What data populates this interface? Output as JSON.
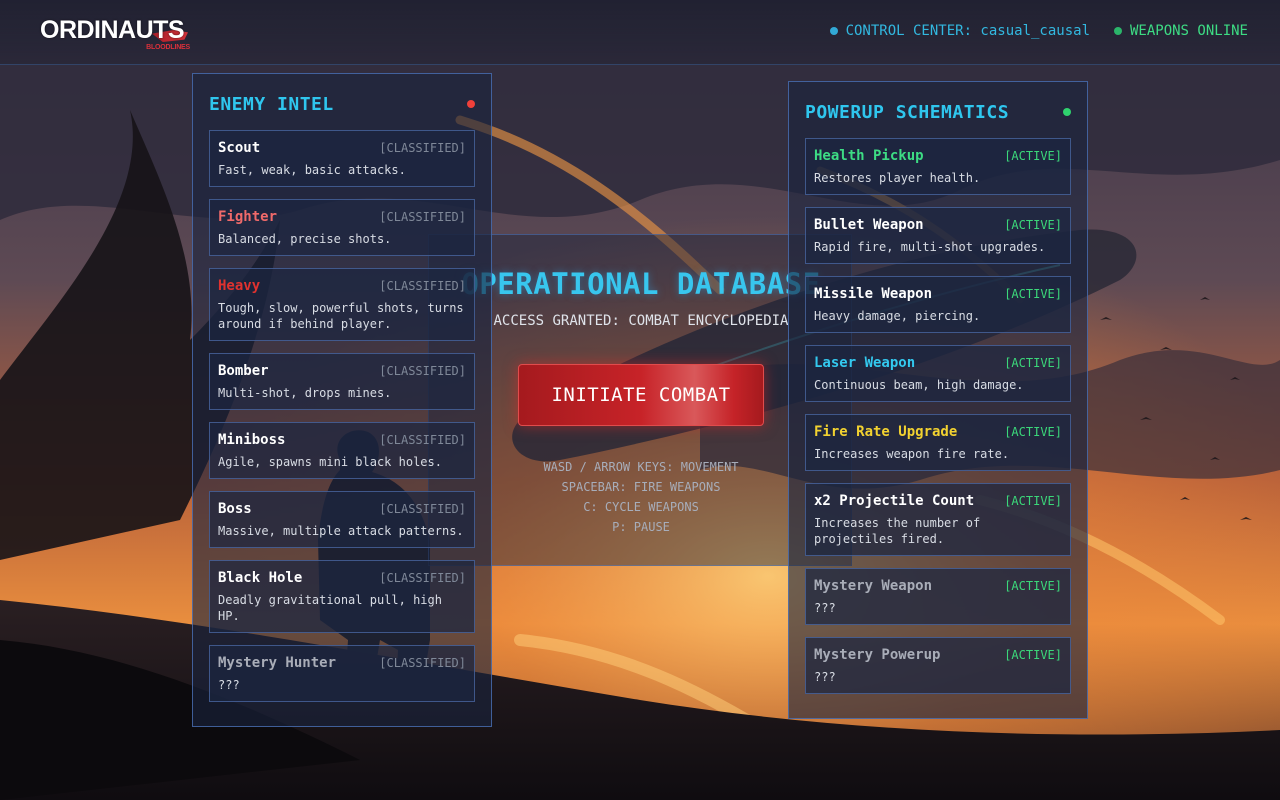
{
  "header": {
    "logo_main": "ORDINAUTS",
    "logo_sub": "BLOODLINES",
    "control_center": "CONTROL CENTER: casual_causal",
    "weapons_status": "WEAPONS ONLINE"
  },
  "colors": {
    "accent_cyan": "#2fc6ee",
    "status_green": "#3ddc84",
    "danger_red": "#c72328",
    "fighter": "#f06a6a",
    "heavy": "#e0322f",
    "laser": "#33c9ef",
    "fire_rate": "#f2d230",
    "health": "#3ddc84",
    "mystery": "#a9adb8"
  },
  "enemy_panel": {
    "title": "ENEMY INTEL",
    "indicator_icon": "status-dot-red",
    "items": [
      {
        "name": "Scout",
        "tag": "[CLASSIFIED]",
        "desc": "Fast, weak, basic attacks.",
        "color": "#ffffff"
      },
      {
        "name": "Fighter",
        "tag": "[CLASSIFIED]",
        "desc": "Balanced, precise shots.",
        "color": "#f06a6a"
      },
      {
        "name": "Heavy",
        "tag": "[CLASSIFIED]",
        "desc": "Tough, slow, powerful shots, turns around if behind player.",
        "color": "#e0322f"
      },
      {
        "name": "Bomber",
        "tag": "[CLASSIFIED]",
        "desc": "Multi-shot, drops mines.",
        "color": "#ffffff"
      },
      {
        "name": "Miniboss",
        "tag": "[CLASSIFIED]",
        "desc": "Agile, spawns mini black holes.",
        "color": "#ffffff"
      },
      {
        "name": "Boss",
        "tag": "[CLASSIFIED]",
        "desc": "Massive, multiple attack patterns.",
        "color": "#ffffff"
      },
      {
        "name": "Black Hole",
        "tag": "[CLASSIFIED]",
        "desc": "Deadly gravitational pull, high HP.",
        "color": "#ffffff"
      },
      {
        "name": "Mystery Hunter",
        "tag": "[CLASSIFIED]",
        "desc": "???",
        "color": "#a9adb8"
      }
    ]
  },
  "powerup_panel": {
    "title": "POWERUP SCHEMATICS",
    "indicator_icon": "status-dot-green",
    "items": [
      {
        "name": "Health Pickup",
        "tag": "[ACTIVE]",
        "desc": "Restores player health.",
        "color": "#3ddc84"
      },
      {
        "name": "Bullet Weapon",
        "tag": "[ACTIVE]",
        "desc": "Rapid fire, multi-shot upgrades.",
        "color": "#ffffff"
      },
      {
        "name": "Missile Weapon",
        "tag": "[ACTIVE]",
        "desc": "Heavy damage, piercing.",
        "color": "#ffffff"
      },
      {
        "name": "Laser Weapon",
        "tag": "[ACTIVE]",
        "desc": "Continuous beam, high damage.",
        "color": "#33c9ef"
      },
      {
        "name": "Fire Rate Upgrade",
        "tag": "[ACTIVE]",
        "desc": "Increases weapon fire rate.",
        "color": "#f2d230"
      },
      {
        "name": "x2 Projectile Count",
        "tag": "[ACTIVE]",
        "desc": "Increases the number of projectiles fired.",
        "color": "#ffffff"
      },
      {
        "name": "Mystery Weapon",
        "tag": "[ACTIVE]",
        "desc": "???",
        "color": "#a9adb8"
      },
      {
        "name": "Mystery Powerup",
        "tag": "[ACTIVE]",
        "desc": "???",
        "color": "#a9adb8"
      }
    ]
  },
  "center": {
    "title": "OPERATIONAL DATABASE",
    "subtitle": "ACCESS GRANTED: COMBAT ENCYCLOPEDIA",
    "button_label": "INITIATE COMBAT",
    "controls": [
      "WASD / ARROW KEYS: MOVEMENT",
      "SPACEBAR: FIRE WEAPONS",
      "C: CYCLE WEAPONS",
      "P: PAUSE"
    ]
  }
}
